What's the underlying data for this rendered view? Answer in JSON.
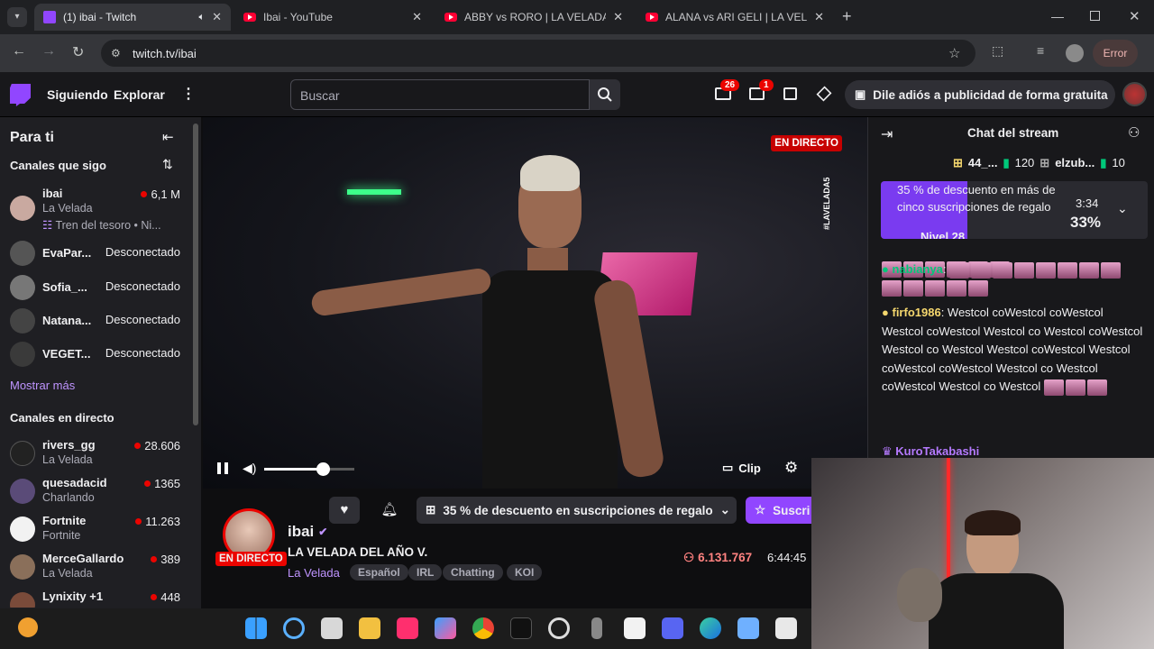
{
  "browser": {
    "tabs": [
      {
        "title": "(1) ibai - Twitch",
        "active": true
      },
      {
        "title": "Ibai - YouTube"
      },
      {
        "title": "ABBY vs RORO | LA VELADA DE"
      },
      {
        "title": "ALANA vs ARI GELI | LA VELADA"
      }
    ],
    "new_tab": "+",
    "url": "twitch.tv/ibai",
    "error_label": "Error"
  },
  "twitch_nav": {
    "following": "Siguiendo",
    "browse": "Explorar",
    "search_placeholder": "Buscar",
    "notif_count": "26",
    "inbox_count": "1",
    "promo": "Dile adiós a publicidad de forma gratuita"
  },
  "sidebar": {
    "title": "Para ti",
    "followed_heading": "Canales que sigo",
    "followed": [
      {
        "name": "ibai",
        "sub": "La Velada",
        "viewers": "6,1 M",
        "extra": "Tren del tesoro • Ni...",
        "avatar_color": "#c9a9a0"
      },
      {
        "name": "EvaPar...",
        "status": "Desconectado",
        "avatar_color": "#555"
      },
      {
        "name": "Sofia_...",
        "status": "Desconectado",
        "avatar_color": "#777"
      },
      {
        "name": "Natana...",
        "status": "Desconectado",
        "avatar_color": "#444"
      },
      {
        "name": "VEGET...",
        "status": "Desconectado",
        "avatar_color": "#3a3a3a"
      }
    ],
    "show_more": "Mostrar más",
    "live_heading": "Canales en directo",
    "live": [
      {
        "name": "rivers_gg",
        "sub": "La Velada",
        "viewers": "28.606",
        "avatar_color": "#222"
      },
      {
        "name": "quesadacid",
        "sub": "Charlando",
        "viewers": "1365",
        "avatar_color": "#5a4b78"
      },
      {
        "name": "Fortnite",
        "sub": "Fortnite",
        "viewers": "11.263",
        "avatar_color": "#f2f2f2"
      },
      {
        "name": "MerceGallardo",
        "sub": "La Velada",
        "viewers": "389",
        "avatar_color": "#8a6f5a"
      },
      {
        "name": "Lynixity +1",
        "sub": "",
        "viewers": "448",
        "avatar_color": "#7a4b3a"
      }
    ]
  },
  "player": {
    "live_label": "EN DIRECTO",
    "clip_label": "Clip",
    "volume": 0.65
  },
  "stream": {
    "channel": "ibai",
    "title": "LA VELADA DEL AÑO V.",
    "category": "La Velada",
    "tags": [
      "Español",
      "IRL",
      "Chatting",
      "KOI"
    ],
    "viewers": "6.131.767",
    "uptime": "6:44:45",
    "live_label": "EN DIRECTO",
    "gift_offer": "35 % de descuento en suscripciones de regalo",
    "subscribe": "Suscri"
  },
  "chat": {
    "title": "Chat del stream",
    "leaderboard": [
      {
        "name": "44_...",
        "score": "120"
      },
      {
        "name": "elzub...",
        "score": "10"
      }
    ],
    "pinned": {
      "text": "35 % de descuento en más de cinco suscripciones de regalo",
      "level": "Nivel 28",
      "timer": "3:34",
      "percent": "33%"
    },
    "messages": [
      {
        "user": "nabianya",
        "color": "#00c87a",
        "text": ""
      },
      {
        "user": "firfo1986",
        "color": "#f5d76e",
        "text": "Westcol coWestcol coWestcol Westcol coWestcol Westcol co Westcol coWestcol Westcol co Westcol Westcol coWestcol Westcol coWestcol coWestcol Westcol co Westcol coWestcol Westcol co Westcol"
      },
      {
        "user": "KuroTakabashi",
        "color": "#b57aff",
        "text": ""
      }
    ]
  },
  "colors": {
    "twitch_purple": "#9146ff",
    "live_red": "#eb0400"
  }
}
